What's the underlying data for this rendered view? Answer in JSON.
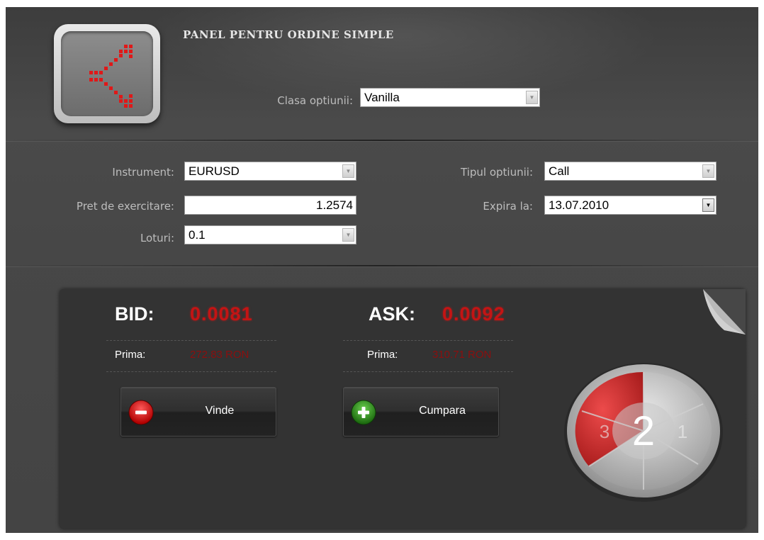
{
  "header": {
    "title": "PANEL PENTRU ORDINE SIMPLE",
    "option_class_label": "Clasa optiunii:",
    "option_class_value": "Vanilla"
  },
  "form": {
    "instrument_label": "Instrument:",
    "instrument_value": "EURUSD",
    "strike_label": "Pret de exercitare:",
    "strike_value": "1.2574",
    "lots_label": "Loturi:",
    "lots_value": "0.1",
    "option_type_label": "Tipul optiunii:",
    "option_type_value": "Call",
    "expiry_label": "Expira la:",
    "expiry_value": "13.07.2010"
  },
  "quote": {
    "bid_label": "BID:",
    "bid_value": "0.0081",
    "ask_label": "ASK:",
    "ask_value": "0.0092",
    "bid_premium_label": "Prima:",
    "bid_premium_value": "272.83 RON",
    "ask_premium_label": "Prima:",
    "ask_premium_value": "310.71 RON",
    "sell_label": "Vinde",
    "buy_label": "Cumpara"
  },
  "countdown": {
    "current": "2",
    "left_number": "3",
    "right_number": "1"
  },
  "colors": {
    "accent_red": "#c41414",
    "panel_bg": "#333333",
    "frame_bg": "#474747",
    "buy_green": "#2e8b1e"
  }
}
